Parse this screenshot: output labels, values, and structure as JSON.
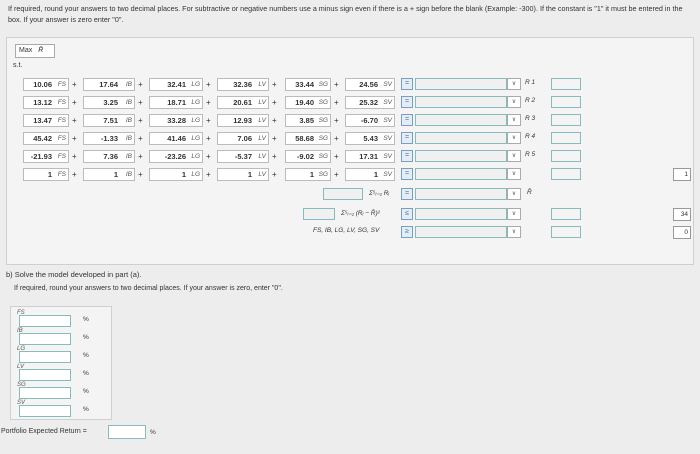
{
  "instructions": "If required, round your answers to two decimal places. For subtractive or negative numbers use a minus sign even if there is a + sign before the blank (Example: -300). If the constant is \"1\" it must be entered in the box. If your answer is zero enter \"0\".",
  "objective_label": "Max",
  "objective_symbol": "R̄",
  "st_label": "s.t.",
  "var_labels": [
    "FS",
    "IB",
    "LG",
    "LV",
    "SG",
    "SV"
  ],
  "rows": [
    {
      "vals": [
        "10.06",
        "17.64",
        "32.41",
        "32.36",
        "33.44",
        "24.56"
      ],
      "op": "=",
      "r": "R 1"
    },
    {
      "vals": [
        "13.12",
        "3.25",
        "18.71",
        "20.61",
        "19.40",
        "25.32"
      ],
      "op": "=",
      "r": "R 2"
    },
    {
      "vals": [
        "13.47",
        "7.51",
        "33.28",
        "12.93",
        "3.85",
        "-6.70"
      ],
      "op": "=",
      "r": "R 3"
    },
    {
      "vals": [
        "45.42",
        "-1.33",
        "41.46",
        "7.06",
        "58.68",
        "5.43"
      ],
      "op": "=",
      "r": "R 4"
    },
    {
      "vals": [
        "-21.93",
        "7.36",
        "-23.26",
        "-5.37",
        "-9.02",
        "17.31"
      ],
      "op": "=",
      "r": "R 5"
    },
    {
      "vals": [
        "1",
        "1",
        "1",
        "1",
        "1",
        "1"
      ],
      "op": "=",
      "r": "",
      "value": "1"
    }
  ],
  "sum_r_label": "Σ⁵ᵢ₌₁ Rᵢ",
  "sum_r_symbol": "R̄",
  "sum_dev_label": "Σ⁵ᵢ₌₁ (Rᵢ − R̄)²",
  "sum_dev_op": "≤",
  "sum_dev_value": "34",
  "nonneg_label": "FS, IB, LG, LV, SG, SV",
  "nonneg_op": "≥",
  "nonneg_value": "0",
  "partb_title": "b) Solve the model developed in part (a).",
  "partb_instr": "If required, round your answers to two decimal places. If your answer is zero, enter \"0\".",
  "partb_rows": [
    "FS",
    "IB",
    "LG",
    "LV",
    "SG",
    "SV"
  ],
  "pct": "%",
  "portfolio_label": "Portfolio Expected Return =",
  "chevron": "∨"
}
